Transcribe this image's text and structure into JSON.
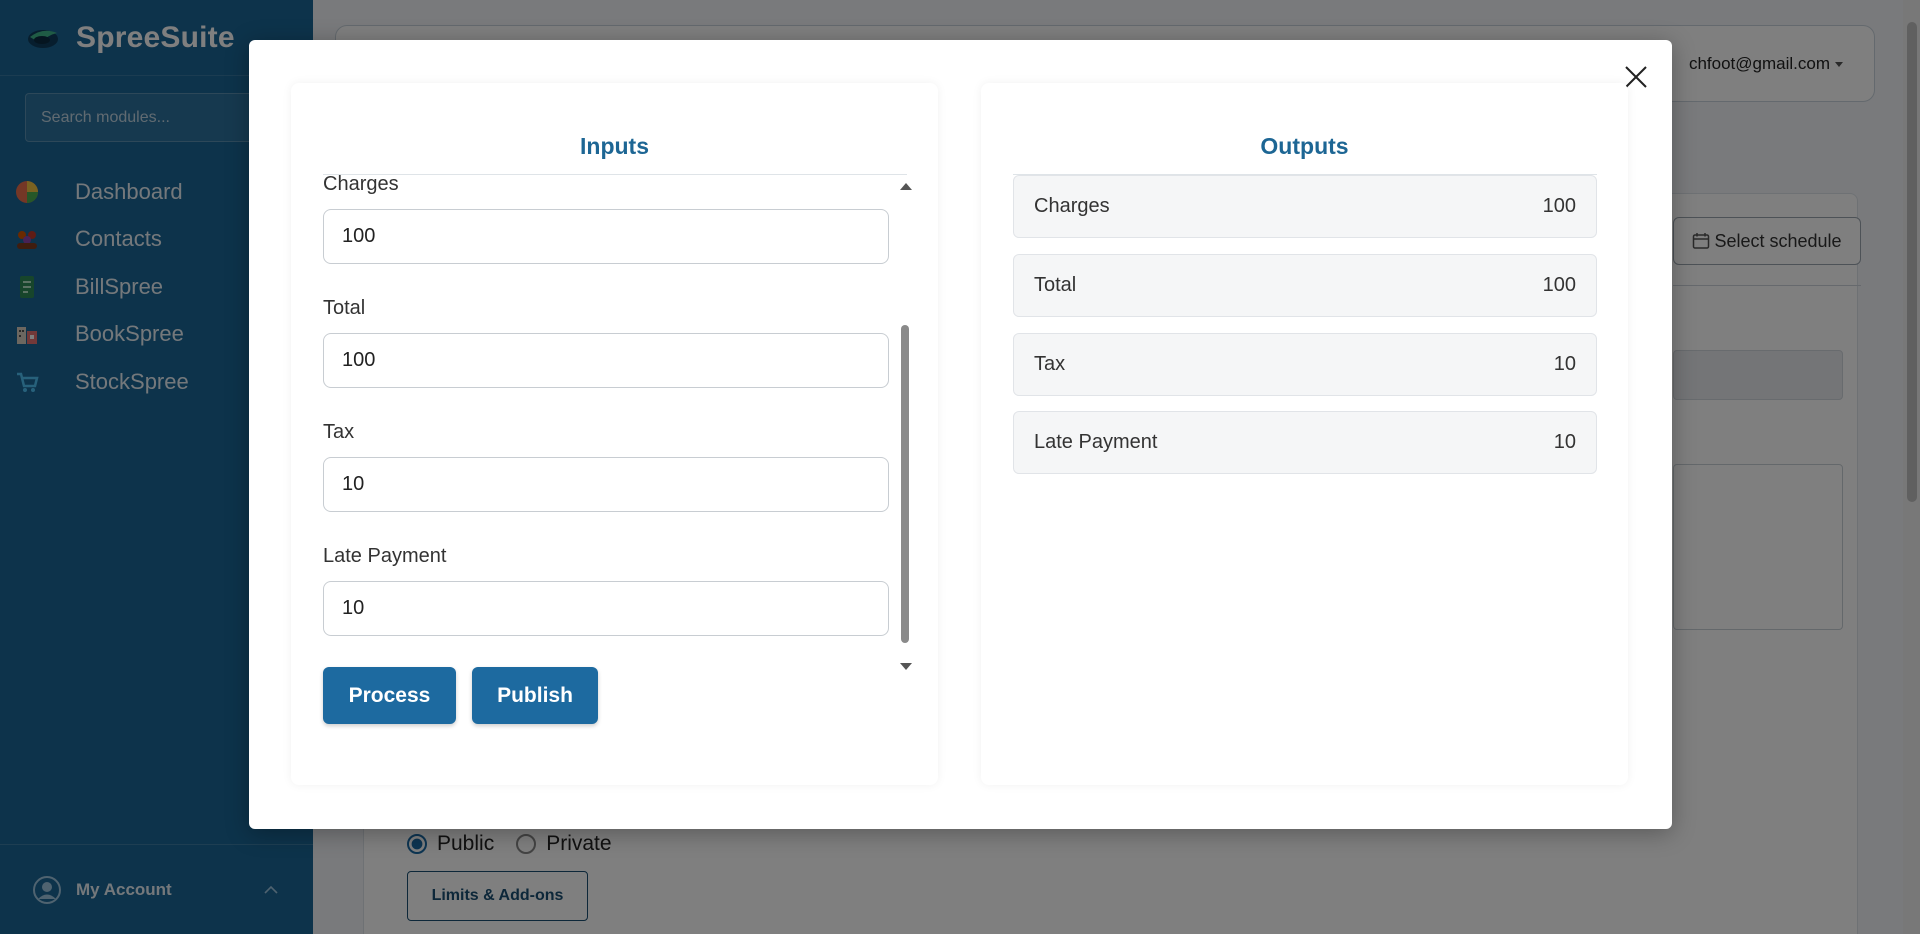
{
  "app": {
    "name": "SpreeSuite"
  },
  "search": {
    "placeholder": "Search modules..."
  },
  "sidebar": {
    "items": [
      {
        "label": "Dashboard",
        "icon": "pie-chart-icon"
      },
      {
        "label": "Contacts",
        "icon": "people-icon"
      },
      {
        "label": "BillSpree",
        "icon": "document-icon"
      },
      {
        "label": "BookSpree",
        "icon": "building-icon"
      },
      {
        "label": "StockSpree",
        "icon": "cart-icon"
      }
    ],
    "account_label": "My Account"
  },
  "header": {
    "user_email": "chfoot@gmail.com"
  },
  "background": {
    "schedule_button": "Select schedule",
    "visibility": {
      "public": "Public",
      "private": "Private",
      "selected": "Public"
    },
    "limits_button": "Limits & Add-ons"
  },
  "modal": {
    "inputs": {
      "title": "Inputs",
      "fields": [
        {
          "label": "Charges",
          "value": "100"
        },
        {
          "label": "Total",
          "value": "100"
        },
        {
          "label": "Tax",
          "value": "10"
        },
        {
          "label": "Late Payment",
          "value": "10"
        }
      ],
      "process_label": "Process",
      "publish_label": "Publish"
    },
    "outputs": {
      "title": "Outputs",
      "rows": [
        {
          "label": "Charges",
          "value": "100"
        },
        {
          "label": "Total",
          "value": "100"
        },
        {
          "label": "Tax",
          "value": "10"
        },
        {
          "label": "Late Payment",
          "value": "10"
        }
      ]
    }
  },
  "colors": {
    "sidebar": "#1b6696",
    "accent": "#1d6aa0",
    "title": "#1d6694"
  }
}
